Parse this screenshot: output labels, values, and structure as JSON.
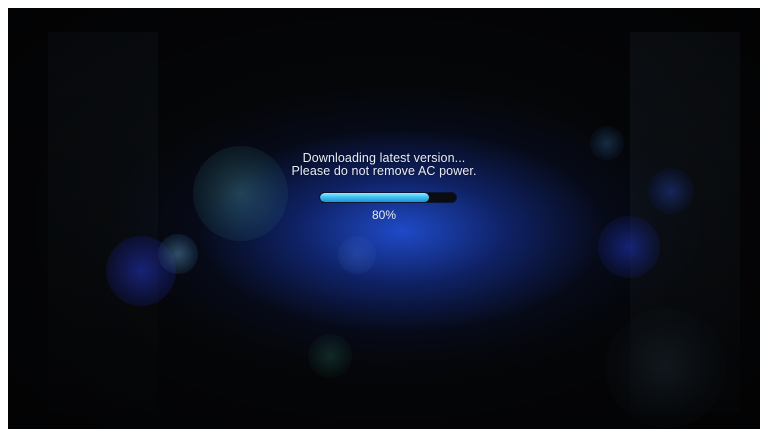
{
  "message": {
    "line1": "Downloading latest version...",
    "line2": "Please do not remove AC power."
  },
  "progress": {
    "value": 0.8,
    "label": "80%"
  },
  "colors": {
    "accent": "#3ec2f2",
    "background": "#050608",
    "glow": "#204ed2"
  }
}
